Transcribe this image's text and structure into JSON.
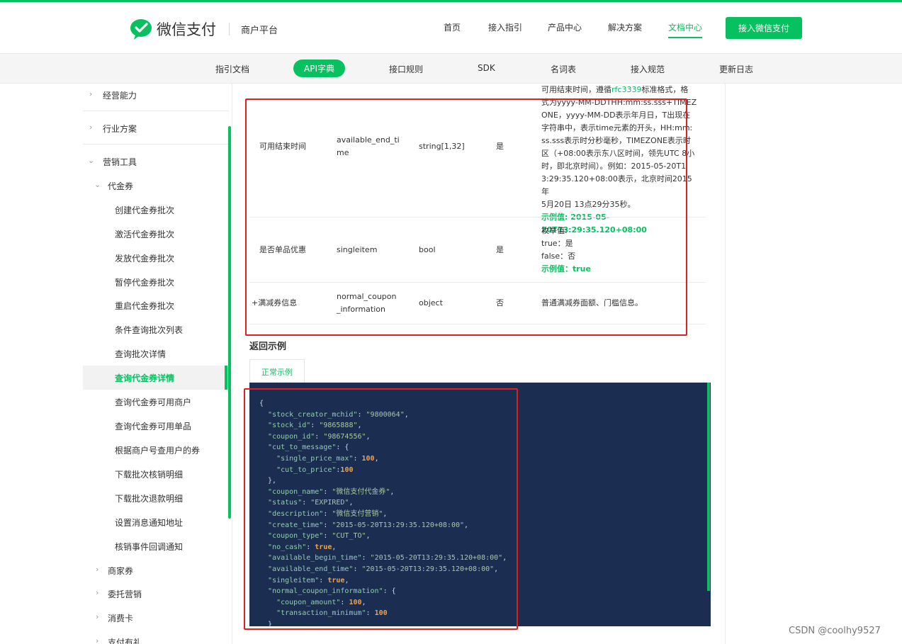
{
  "header": {
    "brand": "微信支付",
    "platform": "商户平台",
    "nav": [
      "首页",
      "接入指引",
      "产品中心",
      "解决方案",
      "文档中心"
    ],
    "active_nav": "文档中心",
    "cta": "接入微信支付"
  },
  "subnav": {
    "items": [
      "指引文档",
      "API字典",
      "接口规则",
      "SDK",
      "名词表",
      "接入规范",
      "更新日志"
    ],
    "active": "API字典"
  },
  "sidebar": {
    "items": [
      {
        "label": "经营能力"
      },
      {
        "label": "行业方案"
      },
      {
        "label": "营销工具"
      },
      {
        "label": "代金券"
      },
      {
        "label": "创建代金券批次"
      },
      {
        "label": "激活代金券批次"
      },
      {
        "label": "发放代金券批次"
      },
      {
        "label": "暂停代金券批次"
      },
      {
        "label": "重启代金券批次"
      },
      {
        "label": "条件查询批次列表"
      },
      {
        "label": "查询批次详情"
      },
      {
        "label": "查询代金券详情"
      },
      {
        "label": "查询代金券可用商户"
      },
      {
        "label": "查询代金券可用单品"
      },
      {
        "label": "根据商户号查用户的券"
      },
      {
        "label": "下载批次核销明细"
      },
      {
        "label": "下载批次退款明细"
      },
      {
        "label": "设置消息通知地址"
      },
      {
        "label": "核销事件回调通知"
      },
      {
        "label": "商家券"
      },
      {
        "label": "委托营销"
      },
      {
        "label": "消费卡"
      },
      {
        "label": "支付有礼"
      }
    ],
    "active": "查询代金券详情"
  },
  "table": {
    "top_desc": "可用结束时间，遵循rfc3339标准格式，格",
    "rows": [
      {
        "name": "可用结束时间",
        "field1": "available_end_ti",
        "field2": "me",
        "type": "string[1,32]",
        "required": "是",
        "desc_lines": [
          "式为yyyy-MM-DDTHH:mm:ss.sss+TIMEZ",
          "ONE，yyyy-MM-DD表示年月日，T出现在",
          "字符串中，表示time元素的开头，HH:mm:",
          "ss.sss表示时分秒毫秒，TIMEZONE表示时",
          "区（+08:00表示东八区时间，领先UTC 8小",
          "时，即北京时间）。例如：2015-05-20T1",
          "3:29:35.120+08:00表示，北京时间2015年",
          "5月20日 13点29分35秒。"
        ],
        "example": "示例值: 2015-05-20T13:29:35.120+08:00"
      },
      {
        "name": "是否单品优惠",
        "field1": "singleitem",
        "field2": "",
        "type": "bool",
        "required": "是",
        "desc_lines": [
          "枚举值:",
          "true：是",
          "false：否"
        ],
        "example": "示例值：true"
      },
      {
        "name": "+满减券信息",
        "field1": "normal_coupon",
        "field2": "_information",
        "type": "object",
        "required": "否",
        "desc_lines": [
          "普通满减券面额、门槛信息。"
        ],
        "example": ""
      }
    ]
  },
  "response": {
    "title": "返回示例",
    "tab": "正常示例"
  },
  "watermark": "CSDN @coolhy9527",
  "colors": {
    "accent": "#07c160",
    "code_bg": "#1b2e52",
    "annotation": "#e02020"
  }
}
